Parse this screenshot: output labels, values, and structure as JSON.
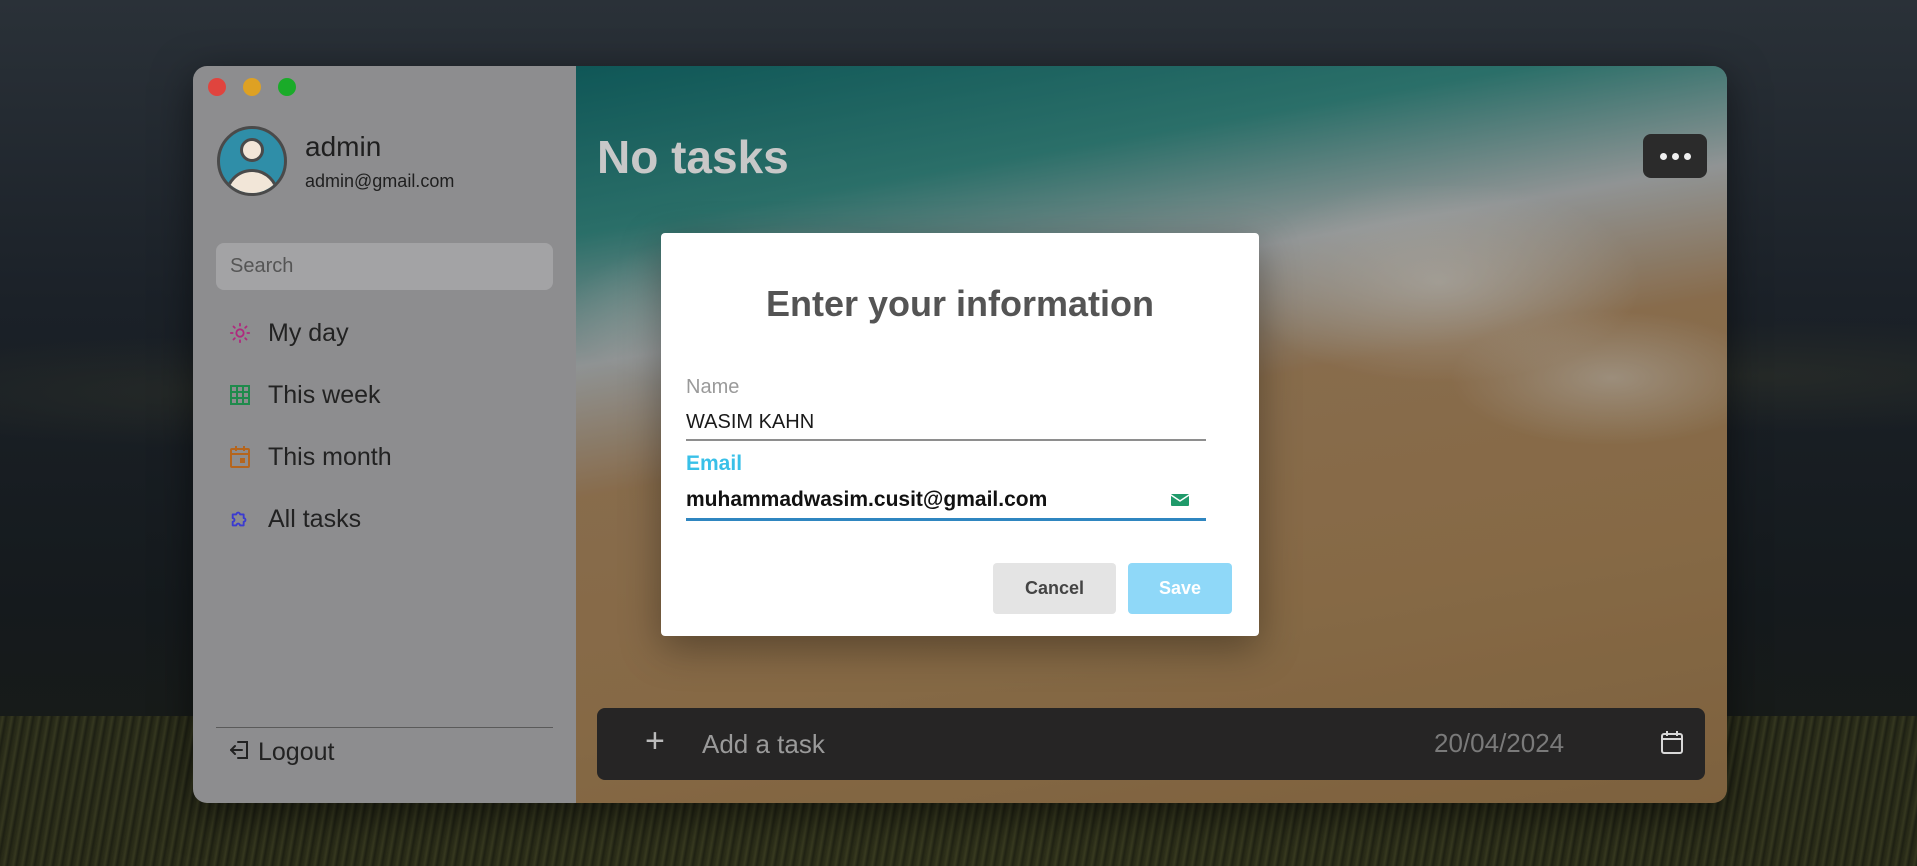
{
  "sidebar": {
    "user": {
      "name": "admin",
      "email": "admin@gmail.com"
    },
    "search": {
      "placeholder": "Search"
    },
    "items": [
      {
        "label": "My day",
        "icon": "sun-icon",
        "color": "#b0287e"
      },
      {
        "label": "This week",
        "icon": "grid-icon",
        "color": "#1f8a4c"
      },
      {
        "label": "This month",
        "icon": "calendar-icon",
        "color": "#b5651d"
      },
      {
        "label": "All tasks",
        "icon": "puzzle-icon",
        "color": "#3b3bd0"
      }
    ],
    "logout_label": "Logout"
  },
  "main": {
    "title": "No tasks",
    "add_task": {
      "placeholder": "Add a task",
      "date": "20/04/2024"
    }
  },
  "modal": {
    "title": "Enter your information",
    "name_label": "Name",
    "name_value": "WASIM KAHN",
    "email_label": "Email",
    "email_value": "muhammadwasim.cusit@gmail.com",
    "cancel_label": "Cancel",
    "save_label": "Save"
  },
  "colors": {
    "accent": "#39c0e8",
    "save_button": "#8fd8f8",
    "email_underline": "#2f86c0"
  }
}
